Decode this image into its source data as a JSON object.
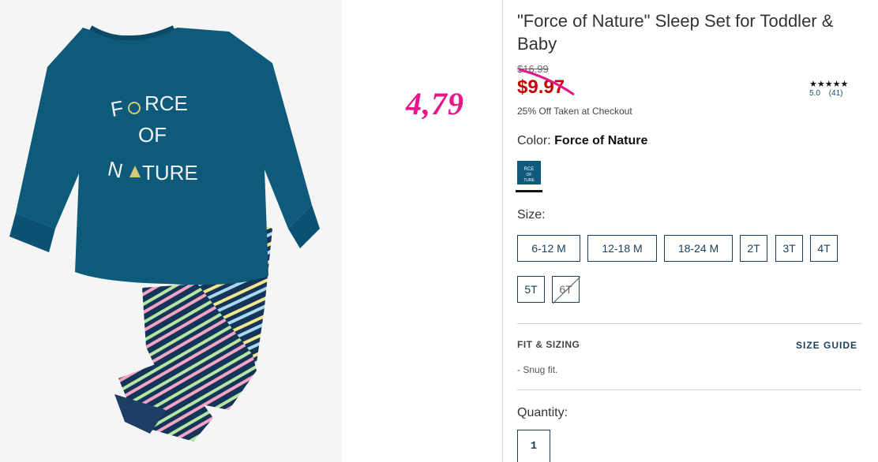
{
  "product": {
    "image_graphic_text": [
      "F",
      "RCE",
      "OF",
      "N",
      "TURE"
    ],
    "title": "\"Force of Nature\" Sleep Set for Toddler & Baby",
    "original_price": "$16.99",
    "sale_price": "$9.97",
    "promo": "25% Off Taken at Checkout",
    "rating": {
      "stars": "★★★★★",
      "score": "5.0",
      "count": "(41)",
      "value": 5.0
    },
    "color": {
      "label": "Color:",
      "name": "Force of Nature",
      "swatch_color": "#0e5a7a"
    },
    "size": {
      "label": "Size:",
      "options": [
        "6-12 M",
        "12-18 M",
        "18-24 M",
        "2T",
        "3T",
        "4T",
        "5T",
        "6T"
      ],
      "unavailable": [
        "6T"
      ]
    },
    "fit": {
      "title": "FIT & SIZING",
      "guide": "SIZE GUIDE",
      "note": "-  Snug fit."
    },
    "quantity": {
      "label": "Quantity:",
      "value": "1"
    }
  },
  "annotation": {
    "text": "4,79",
    "color": "#e8168b"
  },
  "colors": {
    "accent": "#1a3f5c",
    "sale": "#cc0000",
    "shirt": "#0e5a7a"
  }
}
